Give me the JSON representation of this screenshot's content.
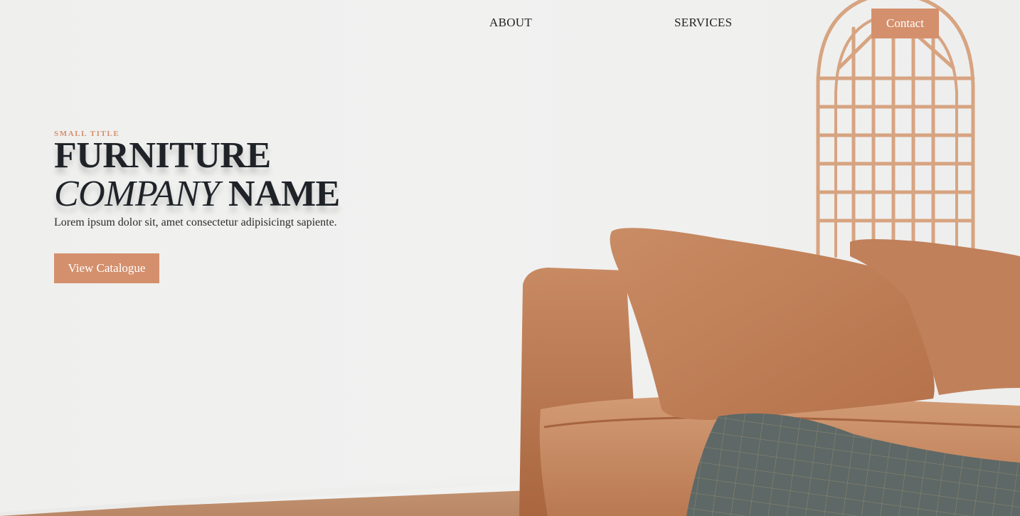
{
  "nav": {
    "about": "ABOUT",
    "services": "SERVICES",
    "contact": "Contact"
  },
  "hero": {
    "small_title": "SMALL TITLE",
    "headline_line1": "FURNITURE",
    "headline_italic": "COMPANY",
    "headline_rest": "NAME",
    "subtitle": "Lorem ipsum dolor sit, amet consectetur adipisicingt sapiente.",
    "cta_label": "View Catalogue"
  },
  "colors": {
    "accent": "#d4906d",
    "text_dark": "#1f2328",
    "background": "#efefee"
  },
  "image": {
    "subject": "sofa-with-cushions-and-rattan-headboard"
  }
}
